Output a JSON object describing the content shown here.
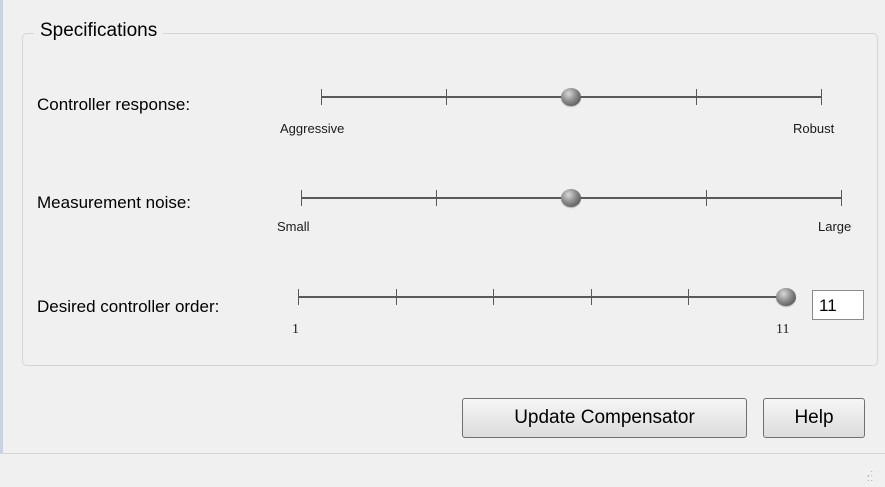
{
  "specifications": {
    "title": "Specifications",
    "controller_response": {
      "label": "Controller response:",
      "min_label": "Aggressive",
      "max_label": "Robust",
      "value_fraction": 0.5,
      "tick_count": 5
    },
    "measurement_noise": {
      "label": "Measurement noise:",
      "min_label": "Small",
      "max_label": "Large",
      "value_fraction": 0.5,
      "tick_count": 5
    },
    "controller_order": {
      "label": "Desired controller order:",
      "min_label": "1",
      "max_label": "11",
      "value": "11",
      "min": 1,
      "max": 11,
      "tick_count": 6
    }
  },
  "buttons": {
    "update_compensator": "Update Compensator",
    "help": "Help"
  }
}
